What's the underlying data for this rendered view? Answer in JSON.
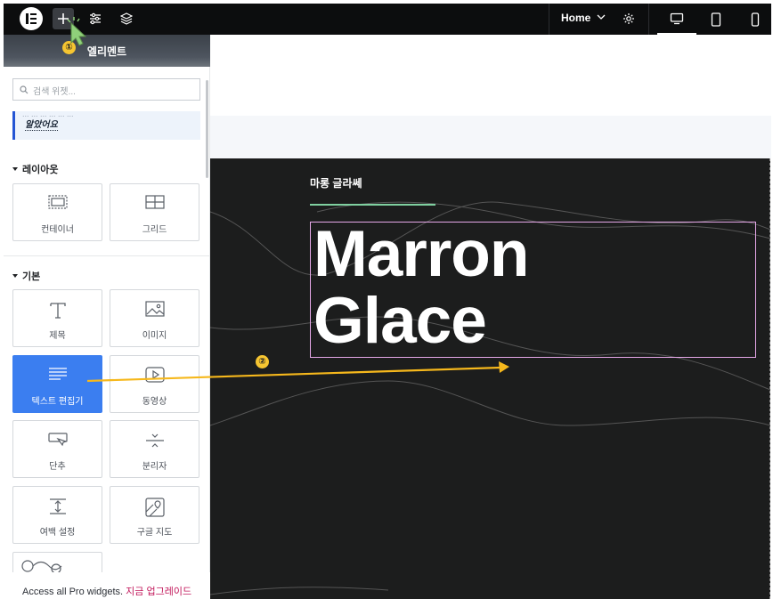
{
  "topbar": {
    "home_label": "Home"
  },
  "panel": {
    "title": "엘리멘트",
    "search_placeholder": "검색 위젯...",
    "notice_clip": "... ... ... ... ... ...",
    "notice_link": "알았어요",
    "sections": [
      {
        "label": "레이아웃"
      },
      {
        "label": "기본"
      }
    ],
    "layout_widgets": [
      {
        "label": "컨테이너",
        "icon": "container-icon"
      },
      {
        "label": "그리드",
        "icon": "grid-icon"
      }
    ],
    "basic_widgets": [
      {
        "label": "제목",
        "icon": "heading-icon"
      },
      {
        "label": "이미지",
        "icon": "image-icon"
      },
      {
        "label": "텍스트 편집기",
        "icon": "text-editor-icon",
        "selected": true
      },
      {
        "label": "동영상",
        "icon": "video-icon"
      },
      {
        "label": "단추",
        "icon": "button-icon"
      },
      {
        "label": "분리자",
        "icon": "divider-icon"
      },
      {
        "label": "여백 설정",
        "icon": "spacer-icon"
      },
      {
        "label": "구글 지도",
        "icon": "google-maps-icon"
      }
    ],
    "pro_text": "Access all Pro widgets.",
    "pro_link": "지금 업그레이드"
  },
  "canvas": {
    "subtitle": "마롱 글라쎄",
    "headline_line1": "Marron",
    "headline_line2": "Glace"
  },
  "annotations": {
    "step1": "①",
    "step2": "②"
  },
  "colors": {
    "topbar": "#0c0d0e",
    "accent_blue": "#3b7ef0",
    "arrow": "#f6b81c",
    "canvas_dark": "#1c1d1d",
    "pro_link": "#c2185b"
  }
}
